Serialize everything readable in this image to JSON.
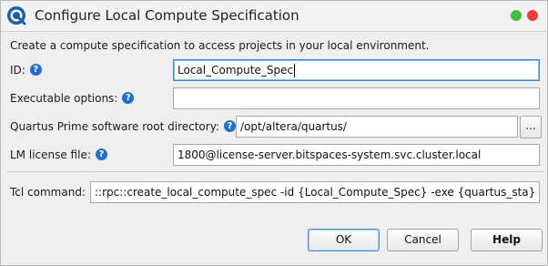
{
  "window": {
    "title": "Configure Local Compute Specification",
    "app_icon": "quartus-logo-icon",
    "controls": {
      "maximize_color": "#3cc43c",
      "close_color": "#f23b3b"
    }
  },
  "intro": "Create a compute specification to access projects in your local environment.",
  "fields": {
    "id": {
      "label": "ID:",
      "value": "Local_Compute_Spec"
    },
    "executable_options": {
      "label": "Executable options:",
      "value": ""
    },
    "root_dir": {
      "label": "Quartus Prime software root directory:",
      "value": "/opt/altera/quartus/",
      "browse_label": "..."
    },
    "license": {
      "label": "LM license file:",
      "value": "1800@license-server.bitspaces-system.svc.cluster.local"
    }
  },
  "help_glyph": "?",
  "tcl": {
    "label": "Tcl command:",
    "value": "::rpc::create_local_compute_spec -id {Local_Compute_Spec} -exe {quartus_sta} -quartus_root {/opt/altera/quartus/}"
  },
  "buttons": {
    "ok": "OK",
    "cancel": "Cancel",
    "help": "Help"
  },
  "colors": {
    "accent": "#1f6fd1",
    "focus": "#3a86d8"
  }
}
